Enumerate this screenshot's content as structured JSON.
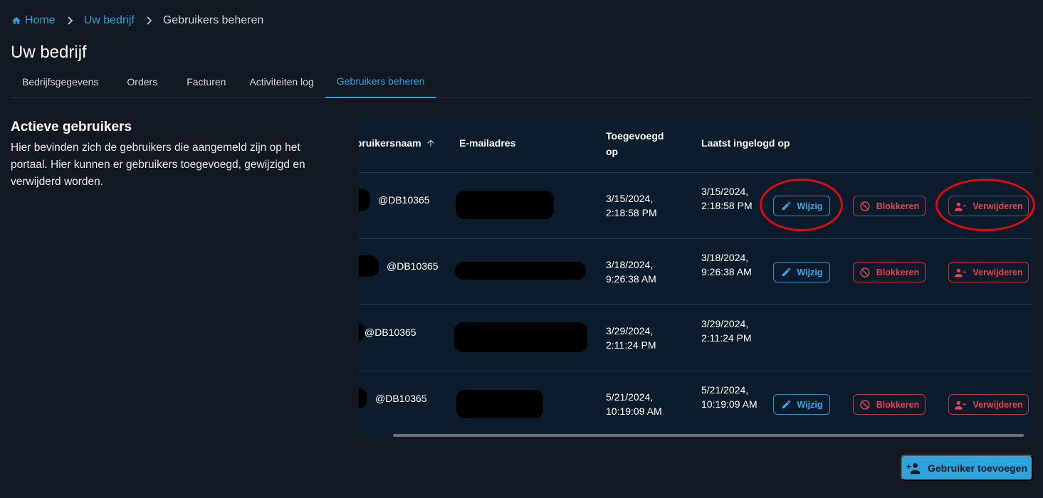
{
  "breadcrumb": {
    "home": "Home",
    "company": "Uw bedrijf",
    "current": "Gebruikers beheren"
  },
  "page_title": "Uw bedrijf",
  "tabs": [
    {
      "label": "Bedrijfsgegevens",
      "active": false
    },
    {
      "label": "Orders",
      "active": false
    },
    {
      "label": "Facturen",
      "active": false
    },
    {
      "label": "Activiteiten log",
      "active": false
    },
    {
      "label": "Gebruikers beheren",
      "active": true
    }
  ],
  "section": {
    "title": "Actieve gebruikers",
    "description": "Hier bevinden zich de gebruikers die aangemeld zijn op het portaal. Hier kunnen er gebruikers toegevoegd, gewijzigd en verwijderd worden."
  },
  "table": {
    "headers": {
      "username": "ebruikersnaam",
      "email": "E-mailadres",
      "added": "Toegevoegd op",
      "last_login": "Laatst ingelogd op"
    },
    "rows": [
      {
        "username": "@DB10365",
        "added": "3/15/2024, 2:18:58 PM",
        "last_login": "3/15/2024, 2:18:58 PM",
        "has_actions": true
      },
      {
        "username": "@DB10365",
        "added": "3/18/2024, 9:26:38 AM",
        "last_login": "3/18/2024, 9:26:38 AM",
        "has_actions": true
      },
      {
        "username": "@DB10365",
        "added": "3/29/2024, 2:11:24 PM",
        "last_login": "3/29/2024, 2:11:24 PM",
        "has_actions": false
      },
      {
        "username": "@DB10365",
        "added": "5/21/2024, 10:19:09 AM",
        "last_login": "5/21/2024, 10:19:09 AM",
        "has_actions": true
      }
    ],
    "actions": {
      "edit": "Wijzig",
      "block": "Blokkeren",
      "delete": "Verwijderen"
    }
  },
  "add_user_button": "Gebruiker toevoegen",
  "colors": {
    "background": "#121923",
    "table_bg": "#0b1d2c",
    "accent": "#2f9fd8",
    "danger": "#e4444b",
    "annotation": "#e10811"
  }
}
